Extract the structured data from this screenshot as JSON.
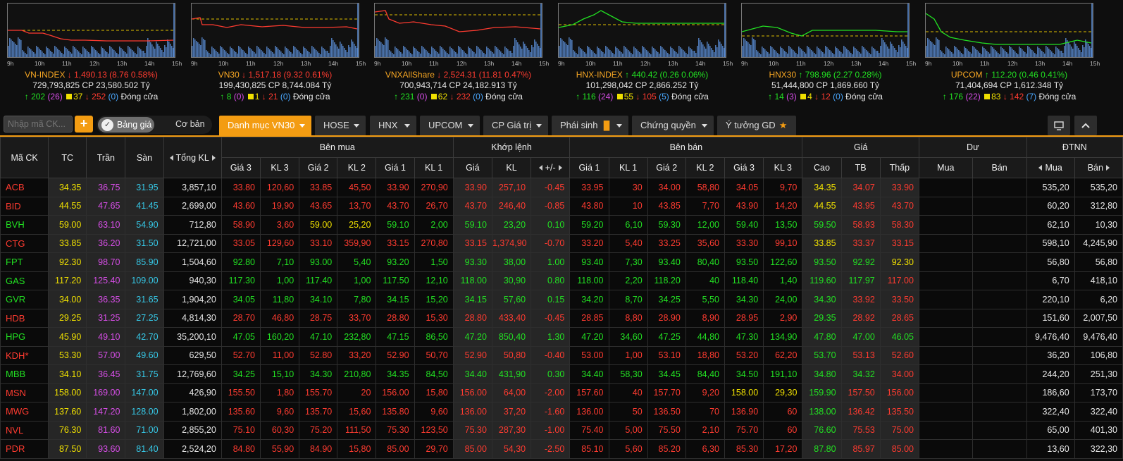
{
  "colors": {
    "accent": "#f39c12",
    "up": "#22e022",
    "down": "#ff3b30",
    "ref": "#f0e000",
    "ceil": "#d84ee8",
    "floor": "#36c9e8"
  },
  "hours": [
    "9h",
    "10h",
    "11h",
    "12h",
    "13h",
    "14h",
    "15h"
  ],
  "indices": [
    {
      "name": "VN-INDEX",
      "dir": "down",
      "value": "1,490.13",
      "change": "(8.76 0.58%)",
      "volume": "729,793,825",
      "cp_label": "CP",
      "cp_value": "23,580.502",
      "unit": "Tỷ",
      "up": "202",
      "ceil": "(26)",
      "ref": "37",
      "down": "252",
      "floor": "(0)",
      "status": "Đóng cửa"
    },
    {
      "name": "VN30",
      "dir": "down",
      "value": "1,517.18",
      "change": "(9.32 0.61%)",
      "volume": "199,430,825",
      "cp_label": "CP",
      "cp_value": "8,744.084",
      "unit": "Tỷ",
      "up": "8",
      "ceil": "(0)",
      "ref": "1",
      "down": "21",
      "floor": "(0)",
      "status": "Đóng cửa"
    },
    {
      "name": "VNXAllShare",
      "dir": "down",
      "value": "2,524.31",
      "change": "(11.81 0.47%)",
      "volume": "700,943,714",
      "cp_label": "CP",
      "cp_value": "24,182.913",
      "unit": "Tỷ",
      "up": "231",
      "ceil": "(0)",
      "ref": "62",
      "down": "232",
      "floor": "(0)",
      "status": "Đóng cửa"
    },
    {
      "name": "HNX-INDEX",
      "dir": "up",
      "value": "440.42",
      "change": "(0.26 0.06%)",
      "volume": "101,298,042",
      "cp_label": "CP",
      "cp_value": "2,866.252",
      "unit": "Tỷ",
      "up": "116",
      "ceil": "(24)",
      "ref": "55",
      "down": "105",
      "floor": "(5)",
      "status": "Đóng cửa"
    },
    {
      "name": "HNX30",
      "dir": "up",
      "value": "798.96",
      "change": "(2.27 0.28%)",
      "volume": "51,444,800",
      "cp_label": "CP",
      "cp_value": "1,869.660",
      "unit": "Tỷ",
      "up": "14",
      "ceil": "(3)",
      "ref": "4",
      "down": "12",
      "floor": "(0)",
      "status": "Đóng cửa"
    },
    {
      "name": "UPCOM",
      "dir": "up",
      "value": "112.20",
      "change": "(0.46 0.41%)",
      "volume": "71,404,694",
      "cp_label": "CP",
      "cp_value": "1,612.348",
      "unit": "Tỷ",
      "up": "176",
      "ceil": "(22)",
      "ref": "83",
      "down": "142",
      "floor": "(7)",
      "status": "Đóng cửa"
    }
  ],
  "toolbar": {
    "search_placeholder": "Nhập mã CK...",
    "plus": "+",
    "toggle_on": "Bảng giá",
    "toggle_off": "Cơ bản",
    "tabs": [
      "Danh mục VN30",
      "HOSE",
      "HNX",
      "UPCOM",
      "CP Giá trị",
      "Phái sinh",
      "Chứng quyền",
      "Ý tưởng GD"
    ]
  },
  "table": {
    "groups": {
      "code": "Mã CK",
      "ref": "TC",
      "ceil": "Trần",
      "floor": "Sàn",
      "total": "Tổng KL",
      "buy": "Bên mua",
      "match": "Khớp lệnh",
      "sell": "Bên bán",
      "price": "Giá",
      "surplus": "Dư",
      "foreign": "ĐTNN"
    },
    "sub": {
      "p3": "Giá 3",
      "v3": "KL 3",
      "p2": "Giá 2",
      "v2": "KL 2",
      "p1": "Giá 1",
      "v1": "KL 1",
      "mp": "Giá",
      "mv": "KL",
      "mc": "+/-",
      "sp1": "Giá 1",
      "sv1": "KL 1",
      "sp2": "Giá 2",
      "sv2": "KL 2",
      "sp3": "Giá 3",
      "sv3": "KL 3",
      "hi": "Cao",
      "avg": "TB",
      "lo": "Thấp",
      "sb": "Mua",
      "ss": "Bán",
      "fb": "Mua",
      "fs": "Bán"
    },
    "rows": [
      {
        "c": "r",
        "sym": "ACB",
        "tc": "34.35",
        "ce": "36.75",
        "fl": "31.95",
        "tkl": "3,857,10",
        "b3": "33.80",
        "bv3": "120,60",
        "b2": "33.85",
        "bv2": "45,50",
        "b1": "33.90",
        "bv1": "270,90",
        "mp": "33.90",
        "mv": "257,10",
        "mc": "-0.45",
        "s1": "33.95",
        "sv1": "30",
        "s2": "34.00",
        "sv2": "58,80",
        "s3": "34.05",
        "sv3": "9,70",
        "hi": "34.35",
        "avg": "34.07",
        "lo": "33.90",
        "fb": "535,20",
        "fs": "535,20",
        "cols": {
          "b3": "r",
          "b2": "r",
          "b1": "r",
          "mp": "r",
          "s1": "r",
          "s2": "r",
          "s3": "r",
          "hi": "y",
          "avg": "r",
          "lo": "r"
        }
      },
      {
        "c": "r",
        "sym": "BID",
        "tc": "44.55",
        "ce": "47.65",
        "fl": "41.45",
        "tkl": "2,699,00",
        "b3": "43.60",
        "bv3": "19,90",
        "b2": "43.65",
        "bv2": "13,70",
        "b1": "43.70",
        "bv1": "26,70",
        "mp": "43.70",
        "mv": "246,40",
        "mc": "-0.85",
        "s1": "43.80",
        "sv1": "10",
        "s2": "43.85",
        "sv2": "7,70",
        "s3": "43.90",
        "sv3": "14,20",
        "hi": "44.55",
        "avg": "43.95",
        "lo": "43.70",
        "fb": "60,20",
        "fs": "312,80",
        "cols": {
          "b3": "r",
          "b2": "r",
          "b1": "r",
          "mp": "r",
          "s1": "r",
          "s2": "r",
          "s3": "r",
          "hi": "y",
          "avg": "r",
          "lo": "r"
        }
      },
      {
        "c": "g",
        "sym": "BVH",
        "tc": "59.00",
        "ce": "63.10",
        "fl": "54.90",
        "tkl": "712,80",
        "b3": "58.90",
        "bv3": "3,60",
        "b2": "59.00",
        "bv2": "25,20",
        "b1": "59.10",
        "bv1": "2,00",
        "mp": "59.10",
        "mv": "23,20",
        "mc": "0.10",
        "s1": "59.20",
        "sv1": "6,10",
        "s2": "59.30",
        "sv2": "12,00",
        "s3": "59.40",
        "sv3": "13,50",
        "hi": "59.50",
        "avg": "58.93",
        "lo": "58.30",
        "fb": "62,10",
        "fs": "10,30",
        "cols": {
          "b3": "r",
          "b2": "y",
          "b1": "g",
          "mp": "g",
          "s1": "g",
          "s2": "g",
          "s3": "g",
          "hi": "g",
          "avg": "r",
          "lo": "r"
        }
      },
      {
        "c": "r",
        "sym": "CTG",
        "tc": "33.85",
        "ce": "36.20",
        "fl": "31.50",
        "tkl": "12,721,00",
        "b3": "33.05",
        "bv3": "129,60",
        "b2": "33.10",
        "bv2": "359,90",
        "b1": "33.15",
        "bv1": "270,80",
        "mp": "33.15",
        "mv": "1,374,90",
        "mc": "-0.70",
        "s1": "33.20",
        "sv1": "5,40",
        "s2": "33.25",
        "sv2": "35,60",
        "s3": "33.30",
        "sv3": "99,10",
        "hi": "33.85",
        "avg": "33.37",
        "lo": "33.15",
        "fb": "598,10",
        "fs": "4,245,90",
        "cols": {
          "b3": "r",
          "b2": "r",
          "b1": "r",
          "mp": "r",
          "s1": "r",
          "s2": "r",
          "s3": "r",
          "hi": "y",
          "avg": "r",
          "lo": "r"
        }
      },
      {
        "c": "g",
        "sym": "FPT",
        "tc": "92.30",
        "ce": "98.70",
        "fl": "85.90",
        "tkl": "1,504,60",
        "b3": "92.80",
        "bv3": "7,10",
        "b2": "93.00",
        "bv2": "5,40",
        "b1": "93.20",
        "bv1": "1,50",
        "mp": "93.30",
        "mv": "38,00",
        "mc": "1.00",
        "s1": "93.40",
        "sv1": "7,30",
        "s2": "93.40",
        "sv2": "80,40",
        "s3": "93.50",
        "sv3": "122,60",
        "hi": "93.50",
        "avg": "92.92",
        "lo": "92.30",
        "fb": "56,80",
        "fs": "56,80",
        "cols": {
          "b3": "g",
          "b2": "g",
          "b1": "g",
          "mp": "g",
          "s1": "g",
          "s2": "g",
          "s3": "g",
          "hi": "g",
          "avg": "g",
          "lo": "y"
        }
      },
      {
        "c": "g",
        "sym": "GAS",
        "tc": "117.20",
        "ce": "125.40",
        "fl": "109.00",
        "tkl": "940,30",
        "b3": "117.30",
        "bv3": "1,00",
        "b2": "117.40",
        "bv2": "1,00",
        "b1": "117.50",
        "bv1": "12,10",
        "mp": "118.00",
        "mv": "30,90",
        "mc": "0.80",
        "s1": "118.00",
        "sv1": "2,20",
        "s2": "118.20",
        "sv2": "40",
        "s3": "118.40",
        "sv3": "1,40",
        "hi": "119.60",
        "avg": "117.97",
        "lo": "117.00",
        "fb": "6,70",
        "fs": "418,10",
        "cols": {
          "b3": "g",
          "b2": "g",
          "b1": "g",
          "mp": "g",
          "s1": "g",
          "s2": "g",
          "s3": "g",
          "hi": "g",
          "avg": "g",
          "lo": "r"
        }
      },
      {
        "c": "g",
        "sym": "GVR",
        "tc": "34.00",
        "ce": "36.35",
        "fl": "31.65",
        "tkl": "1,904,20",
        "b3": "34.05",
        "bv3": "11,80",
        "b2": "34.10",
        "bv2": "7,80",
        "b1": "34.15",
        "bv1": "15,20",
        "mp": "34.15",
        "mv": "57,60",
        "mc": "0.15",
        "s1": "34.20",
        "sv1": "8,70",
        "s2": "34.25",
        "sv2": "5,50",
        "s3": "34.30",
        "sv3": "24,00",
        "hi": "34.30",
        "avg": "33.92",
        "lo": "33.50",
        "fb": "220,10",
        "fs": "6,20",
        "cols": {
          "b3": "g",
          "b2": "g",
          "b1": "g",
          "mp": "g",
          "s1": "g",
          "s2": "g",
          "s3": "g",
          "hi": "g",
          "avg": "r",
          "lo": "r"
        }
      },
      {
        "c": "r",
        "sym": "HDB",
        "tc": "29.25",
        "ce": "31.25",
        "fl": "27.25",
        "tkl": "4,814,30",
        "b3": "28.70",
        "bv3": "46,80",
        "b2": "28.75",
        "bv2": "33,70",
        "b1": "28.80",
        "bv1": "15,30",
        "mp": "28.80",
        "mv": "433,40",
        "mc": "-0.45",
        "s1": "28.85",
        "sv1": "8,80",
        "s2": "28.90",
        "sv2": "8,90",
        "s3": "28.95",
        "sv3": "2,90",
        "hi": "29.35",
        "avg": "28.92",
        "lo": "28.65",
        "fb": "151,60",
        "fs": "2,007,50",
        "cols": {
          "b3": "r",
          "b2": "r",
          "b1": "r",
          "mp": "r",
          "s1": "r",
          "s2": "r",
          "s3": "r",
          "hi": "g",
          "avg": "r",
          "lo": "r"
        }
      },
      {
        "c": "g",
        "sym": "HPG",
        "tc": "45.90",
        "ce": "49.10",
        "fl": "42.70",
        "tkl": "35,200,10",
        "b3": "47.05",
        "bv3": "160,20",
        "b2": "47.10",
        "bv2": "232,80",
        "b1": "47.15",
        "bv1": "86,50",
        "mp": "47.20",
        "mv": "850,40",
        "mc": "1.30",
        "s1": "47.20",
        "sv1": "34,60",
        "s2": "47.25",
        "sv2": "44,80",
        "s3": "47.30",
        "sv3": "134,90",
        "hi": "47.80",
        "avg": "47.00",
        "lo": "46.05",
        "fb": "9,476,40",
        "fs": "9,476,40",
        "cols": {
          "b3": "g",
          "b2": "g",
          "b1": "g",
          "mp": "g",
          "s1": "g",
          "s2": "g",
          "s3": "g",
          "hi": "g",
          "avg": "g",
          "lo": "g"
        }
      },
      {
        "c": "r",
        "sym": "KDH*",
        "tc": "53.30",
        "ce": "57.00",
        "fl": "49.60",
        "tkl": "629,50",
        "b3": "52.70",
        "bv3": "11,00",
        "b2": "52.80",
        "bv2": "33,20",
        "b1": "52.90",
        "bv1": "50,70",
        "mp": "52.90",
        "mv": "50,80",
        "mc": "-0.40",
        "s1": "53.00",
        "sv1": "1,00",
        "s2": "53.10",
        "sv2": "18,80",
        "s3": "53.20",
        "sv3": "62,20",
        "hi": "53.70",
        "avg": "53.13",
        "lo": "52.60",
        "fb": "36,20",
        "fs": "106,80",
        "cols": {
          "b3": "r",
          "b2": "r",
          "b1": "r",
          "mp": "r",
          "s1": "r",
          "s2": "r",
          "s3": "r",
          "hi": "g",
          "avg": "r",
          "lo": "r"
        }
      },
      {
        "c": "g",
        "sym": "MBB",
        "tc": "34.10",
        "ce": "36.45",
        "fl": "31.75",
        "tkl": "12,769,60",
        "b3": "34.25",
        "bv3": "15,10",
        "b2": "34.30",
        "bv2": "210,80",
        "b1": "34.35",
        "bv1": "84,50",
        "mp": "34.40",
        "mv": "431,90",
        "mc": "0.30",
        "s1": "34.40",
        "sv1": "58,30",
        "s2": "34.45",
        "sv2": "84,40",
        "s3": "34.50",
        "sv3": "191,10",
        "hi": "34.80",
        "avg": "34.32",
        "lo": "34.00",
        "fb": "244,20",
        "fs": "251,30",
        "cols": {
          "b3": "g",
          "b2": "g",
          "b1": "g",
          "mp": "g",
          "s1": "g",
          "s2": "g",
          "s3": "g",
          "hi": "g",
          "avg": "g",
          "lo": "r"
        }
      },
      {
        "c": "r",
        "sym": "MSN",
        "tc": "158.00",
        "ce": "169.00",
        "fl": "147.00",
        "tkl": "426,90",
        "b3": "155.50",
        "bv3": "1,80",
        "b2": "155.70",
        "bv2": "20",
        "b1": "156.00",
        "bv1": "15,80",
        "mp": "156.00",
        "mv": "64,00",
        "mc": "-2.00",
        "s1": "157.60",
        "sv1": "40",
        "s2": "157.70",
        "sv2": "9,20",
        "s3": "158.00",
        "sv3": "29,30",
        "hi": "159.90",
        "avg": "157.50",
        "lo": "156.00",
        "fb": "186,60",
        "fs": "173,70",
        "cols": {
          "b3": "r",
          "b2": "r",
          "b1": "r",
          "mp": "r",
          "s1": "r",
          "s2": "r",
          "s3": "y",
          "hi": "g",
          "avg": "r",
          "lo": "r"
        }
      },
      {
        "c": "r",
        "sym": "MWG",
        "tc": "137.60",
        "ce": "147.20",
        "fl": "128.00",
        "tkl": "1,802,00",
        "b3": "135.60",
        "bv3": "9,60",
        "b2": "135.70",
        "bv2": "15,60",
        "b1": "135.80",
        "bv1": "9,60",
        "mp": "136.00",
        "mv": "37,20",
        "mc": "-1.60",
        "s1": "136.00",
        "sv1": "50",
        "s2": "136.50",
        "sv2": "70",
        "s3": "136.90",
        "sv3": "60",
        "hi": "138.00",
        "avg": "136.42",
        "lo": "135.50",
        "fb": "322,40",
        "fs": "322,40",
        "cols": {
          "b3": "r",
          "b2": "r",
          "b1": "r",
          "mp": "r",
          "s1": "r",
          "s2": "r",
          "s3": "r",
          "hi": "g",
          "avg": "r",
          "lo": "r"
        }
      },
      {
        "c": "r",
        "sym": "NVL",
        "tc": "76.30",
        "ce": "81.60",
        "fl": "71.00",
        "tkl": "2,855,20",
        "b3": "75.10",
        "bv3": "60,30",
        "b2": "75.20",
        "bv2": "111,50",
        "b1": "75.30",
        "bv1": "123,50",
        "mp": "75.30",
        "mv": "287,30",
        "mc": "-1.00",
        "s1": "75.40",
        "sv1": "5,00",
        "s2": "75.50",
        "sv2": "2,10",
        "s3": "75.70",
        "sv3": "60",
        "hi": "76.60",
        "avg": "75.53",
        "lo": "75.00",
        "fb": "65,00",
        "fs": "401,30",
        "cols": {
          "b3": "r",
          "b2": "r",
          "b1": "r",
          "mp": "r",
          "s1": "r",
          "s2": "r",
          "s3": "r",
          "hi": "g",
          "avg": "r",
          "lo": "r"
        }
      },
      {
        "c": "r",
        "sym": "PDR",
        "tc": "87.50",
        "ce": "93.60",
        "fl": "81.40",
        "tkl": "2,524,20",
        "b3": "84.80",
        "bv3": "55,90",
        "b2": "84.90",
        "bv2": "15,80",
        "b1": "85.00",
        "bv1": "29,70",
        "mp": "85.00",
        "mv": "54,30",
        "mc": "-2.50",
        "s1": "85.10",
        "sv1": "5,60",
        "s2": "85.20",
        "sv2": "6,30",
        "s3": "85.30",
        "sv3": "17,20",
        "hi": "87.80",
        "avg": "85.97",
        "lo": "85.00",
        "fb": "13,60",
        "fs": "322,30",
        "cols": {
          "b3": "r",
          "b2": "r",
          "b1": "r",
          "mp": "r",
          "s1": "r",
          "s2": "r",
          "s3": "r",
          "hi": "g",
          "avg": "r",
          "lo": "r"
        }
      }
    ]
  }
}
